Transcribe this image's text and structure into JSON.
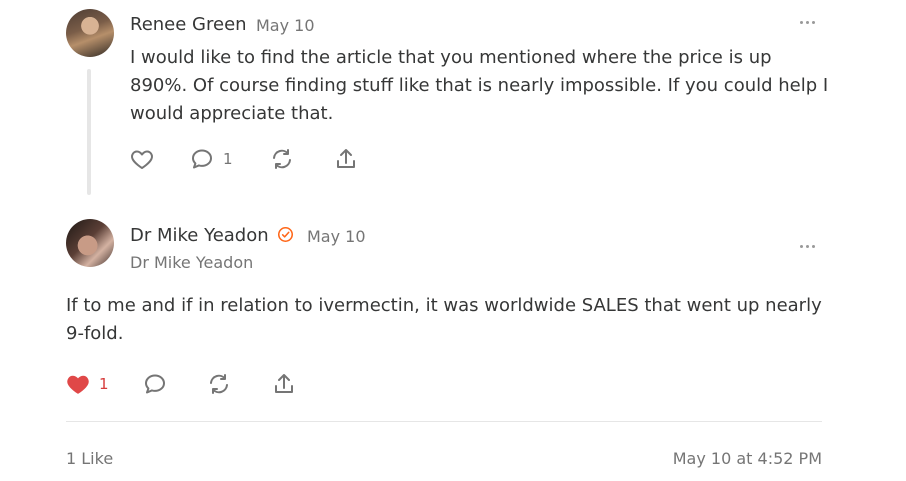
{
  "comment1": {
    "author": "Renee Green",
    "date": "May 10",
    "text": "I would like to find the article that you mentioned where the price is up 890%. Of course finding stuff like that is nearly impossible. If you could help I would appreciate that.",
    "reply_count": "1"
  },
  "comment2": {
    "author": "Dr Mike Yeadon",
    "date": "May 10",
    "subtitle": "Dr Mike Yeadon",
    "text": "If to me and if in relation to ivermectin, it was worldwide SALES that went up nearly 9-fold.",
    "like_count": "1",
    "liked": true
  },
  "footer": {
    "likes": "1 Like",
    "timestamp": "May 10 at 4:52 PM"
  },
  "colors": {
    "text": "#363737",
    "muted": "#757575",
    "heart": "#e04848",
    "verified": "#ff6719"
  }
}
